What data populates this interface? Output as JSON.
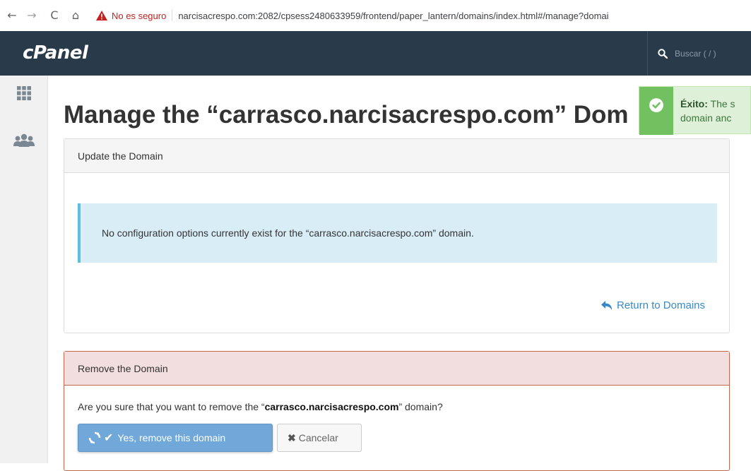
{
  "browser": {
    "nav": {
      "back": "←",
      "forward": "→",
      "reload": "C",
      "home": "⌂"
    },
    "security_label": "No es seguro",
    "url": "narcisacrespo.com:2082/cpsess2480633959/frontend/paper_lantern/domains/index.html#/manage?domai"
  },
  "header": {
    "logo": "cPanel",
    "search_placeholder": "Buscar ( / )"
  },
  "sidebar": {
    "items": [
      {
        "icon": "grid-icon"
      },
      {
        "icon": "users-icon"
      }
    ]
  },
  "page": {
    "title": "Manage the “carrasco.narcisacrespo.com” Dom"
  },
  "notice": {
    "status": "success",
    "label": "Éxito:",
    "line1_rest": " The s",
    "line2": "domain anc"
  },
  "update_panel": {
    "heading": "Update the Domain",
    "info": "No configuration options currently exist for the “carrasco.narcisacrespo.com” domain.",
    "return_link": "Return to Domains"
  },
  "remove_panel": {
    "heading": "Remove the Domain",
    "question_prefix": "Are you sure that you want to remove the “",
    "domain": "carrasco.narcisacrespo.com",
    "question_suffix": "” domain?",
    "confirm_button": "Yes, remove this domain",
    "cancel_button": "Cancelar"
  },
  "colors": {
    "header_bg": "#293a4a",
    "info_bg": "#d9edf7",
    "info_border": "#5bc0de",
    "success_bar": "#72c160",
    "danger_head_bg": "#f2dede",
    "danger_border": "#c16a4a",
    "primary_button": "#6fa8d9",
    "link": "#3a87c8"
  }
}
